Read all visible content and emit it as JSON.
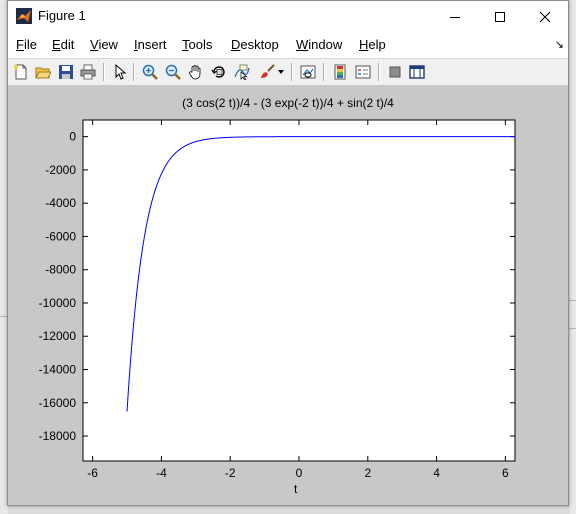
{
  "window": {
    "title": "Figure 1"
  },
  "menu": [
    {
      "label": "File",
      "u": "F",
      "rest": "ile"
    },
    {
      "label": "Edit",
      "u": "E",
      "rest": "dit"
    },
    {
      "label": "View",
      "u": "V",
      "rest": "iew"
    },
    {
      "label": "Insert",
      "u": "I",
      "rest": "nsert"
    },
    {
      "label": "Tools",
      "u": "T",
      "rest": "ools"
    },
    {
      "label": "Desktop",
      "u": "D",
      "rest": "esktop"
    },
    {
      "label": "Window",
      "u": "W",
      "rest": "indow"
    },
    {
      "label": "Help",
      "u": "H",
      "rest": "elp"
    }
  ],
  "toolbar_icons": [
    "new-figure-icon",
    "open-file-icon",
    "save-icon",
    "print-icon",
    "edit-plot-arrow-icon",
    "zoom-in-icon",
    "zoom-out-icon",
    "pan-hand-icon",
    "rotate-3d-icon",
    "data-cursor-icon",
    "brush-icon",
    "brush-dropdown-icon",
    "link-plot-icon",
    "colorbar-icon",
    "legend-icon",
    "hide-plot-tools-icon",
    "show-plot-tools-icon"
  ],
  "colors": {
    "line": "#0000ff",
    "figure_bg": "#c8c8c8",
    "axes_bg": "#ffffff"
  },
  "chart_data": {
    "type": "line",
    "title": "(3 cos(2 t))/4 - (3 exp(-2 t))/4 + sin(2 t)/4",
    "xlabel": "t",
    "ylabel": "",
    "xlim": [
      -6.28,
      6.28
    ],
    "ylim": [
      -19500,
      1000
    ],
    "xticks": [
      -6,
      -4,
      -2,
      0,
      2,
      4,
      6
    ],
    "yticks": [
      0,
      -2000,
      -4000,
      -6000,
      -8000,
      -10000,
      -12000,
      -14000,
      -16000,
      -18000
    ],
    "grid": false,
    "series": [
      {
        "function": "(3 cos(2 t))/4 - (3 exp(-2 t))/4 + sin(2 t)/4",
        "x": [
          -5.0,
          -4.8,
          -4.6,
          -4.4,
          -4.2,
          -4.0,
          -3.8,
          -3.6,
          -3.4,
          -3.2,
          -3.0,
          -2.8,
          -2.6,
          -2.4,
          -2.2,
          -2.0,
          -1.5,
          -1.0,
          0,
          2,
          4,
          6.28
        ],
        "y": [
          -16520,
          -11070,
          -7420,
          -4970,
          -3340,
          -2240,
          -1500,
          -1010,
          -673,
          -451,
          -303,
          -203,
          -136,
          -91,
          -62,
          -41,
          -15,
          -6,
          0,
          0,
          0,
          0
        ]
      }
    ]
  }
}
